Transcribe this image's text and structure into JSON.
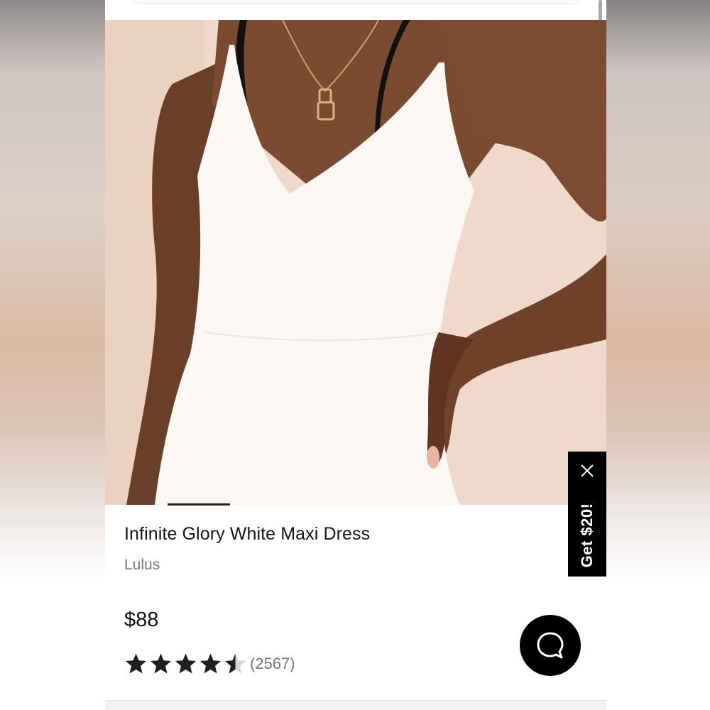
{
  "product": {
    "title": "Infinite Glory White Maxi Dress",
    "brand": "Lulus",
    "price": "$88",
    "rating_value": 4.5,
    "rating_max": 5,
    "review_count": "(2567)"
  },
  "gallery": {
    "image_description": "",
    "image_alt": "Infinite Glory White Maxi Dress"
  },
  "promo": {
    "label": "Get $20!",
    "close_icon": "close-icon"
  },
  "chat": {
    "icon": "chat-bubble-icon"
  },
  "colors": {
    "star": "#1f1f1f",
    "promo_bg": "#000000",
    "chat_bg": "#000000"
  }
}
